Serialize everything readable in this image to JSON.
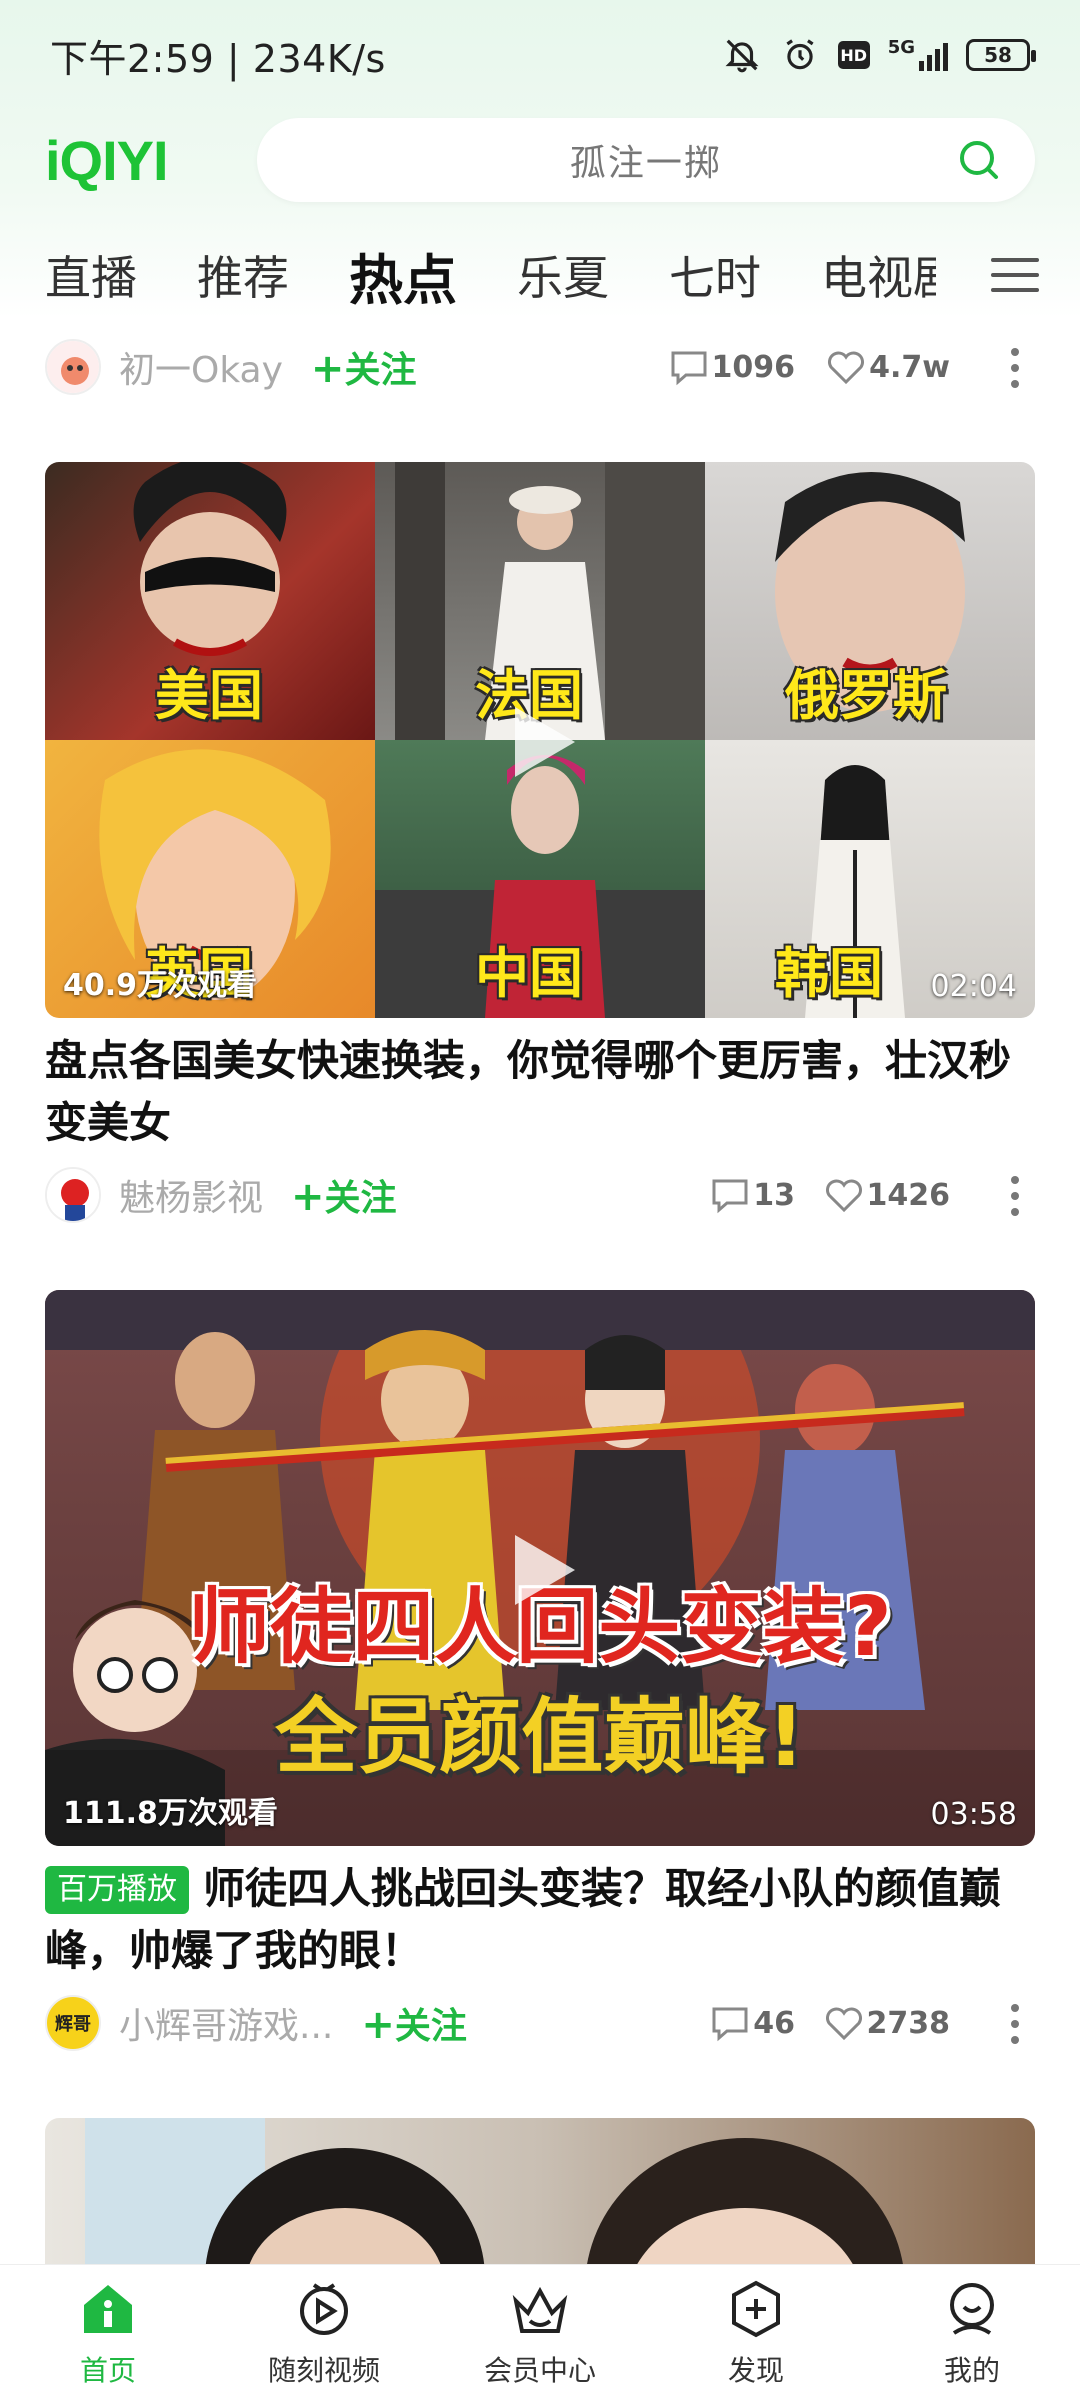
{
  "status_bar": {
    "time_speed": "下午2:59 | 234K/s",
    "network": "5G",
    "hd": "HD",
    "battery": "58"
  },
  "header": {
    "logo": "iQIYI",
    "search_placeholder": "孤注一掷"
  },
  "tabs": [
    {
      "label": "直播"
    },
    {
      "label": "推荐"
    },
    {
      "label": "热点"
    },
    {
      "label": "乐夏"
    },
    {
      "label": "七时"
    },
    {
      "label": "电视剧"
    }
  ],
  "feed": [
    {
      "author": "初一Okay",
      "follow": "关注",
      "comments": "1096",
      "likes": "4.7w"
    },
    {
      "views": "40.9万次观看",
      "duration": "02:04",
      "collage_labels": [
        "美国",
        "法国",
        "俄罗斯",
        "英国",
        "中国",
        "韩国"
      ],
      "title": "盘点各国美女快速换装，你觉得哪个更厉害，壮汉秒变美女",
      "author": "魅杨影视",
      "follow": "关注",
      "comments": "13",
      "likes": "1426"
    },
    {
      "views": "111.8万次观看",
      "duration": "03:58",
      "thumb_text_1": "师徒四人回头变装?",
      "thumb_text_2": "全员颜值巅峰!",
      "badge": "百万播放",
      "title": "师徒四人挑战回头变装？取经小队的颜值巅峰，帅爆了我的眼！",
      "author": "小辉哥游戏...",
      "avatar_text": "辉哥",
      "follow": "关注",
      "comments": "46",
      "likes": "2738"
    }
  ],
  "bottom_nav": [
    {
      "label": "首页"
    },
    {
      "label": "随刻视频"
    },
    {
      "label": "会员中心"
    },
    {
      "label": "发现"
    },
    {
      "label": "我的"
    }
  ],
  "colors": {
    "brand_green": "#1fb842",
    "logo_green": "#1ec336"
  }
}
